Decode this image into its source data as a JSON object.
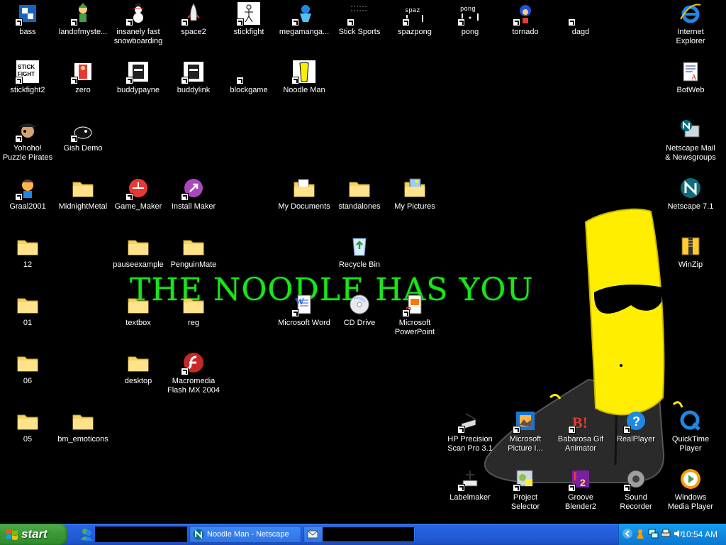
{
  "wallpaper": {
    "tagline": "THE NOODLE HAS YOU",
    "colors": {
      "background": "#000000",
      "tagline": "#1be41b",
      "noodle": "#ffee00",
      "boot": "#2a2a2a"
    }
  },
  "desktop": {
    "icons": [
      {
        "label": "bass",
        "icon": "character-sprite-icon"
      },
      {
        "label": "landofmyste...",
        "icon": "elf-sprite-icon"
      },
      {
        "label": "insanely fast snowboarding",
        "icon": "snowman-icon"
      },
      {
        "label": "space2",
        "icon": "space-shuttle-icon"
      },
      {
        "label": "stickfight",
        "icon": "stick-figure-icon"
      },
      {
        "label": "megamanga...",
        "icon": "megaman-sprite-icon"
      },
      {
        "label": "Stick Sports",
        "icon": "stick-sports-icon"
      },
      {
        "label": "spazpong",
        "icon": "spazpong-icon"
      },
      {
        "label": "pong",
        "icon": "pong-icon"
      },
      {
        "label": "tornado",
        "icon": "sonic-sprite-icon"
      },
      {
        "label": "dagd",
        "icon": "blank-shortcut-icon"
      },
      {
        "label": "Internet Explorer",
        "icon": "internet-explorer-icon"
      },
      {
        "label": "stickfight2",
        "icon": "stick-fight-logo-icon"
      },
      {
        "label": "zero",
        "icon": "zero-sprite-icon"
      },
      {
        "label": "buddypayne",
        "icon": "buddy-face-icon"
      },
      {
        "label": "buddylink",
        "icon": "buddy-face-icon"
      },
      {
        "label": "blockgame",
        "icon": "blank-shortcut-icon"
      },
      {
        "label": "Noodle Man",
        "icon": "noodle-man-icon"
      },
      {
        "label": "BotWeb",
        "icon": "web-document-icon"
      },
      {
        "label": "Yohoho! Puzzle Pirates",
        "icon": "pirate-icon"
      },
      {
        "label": "Gish Demo",
        "icon": "gish-blob-icon"
      },
      {
        "label": "Netscape Mail & Newsgroups",
        "icon": "netscape-mail-icon"
      },
      {
        "label": "Graal2001",
        "icon": "graal-character-icon"
      },
      {
        "label": "MidnightMetal",
        "icon": "folder-icon"
      },
      {
        "label": "Game_Maker",
        "icon": "game-maker-icon"
      },
      {
        "label": "Install Maker",
        "icon": "install-maker-icon"
      },
      {
        "label": "My Documents",
        "icon": "my-documents-folder-icon"
      },
      {
        "label": "standalones",
        "icon": "folder-icon"
      },
      {
        "label": "My Pictures",
        "icon": "my-pictures-folder-icon"
      },
      {
        "label": "Netscape 7.1",
        "icon": "netscape-icon"
      },
      {
        "label": "12",
        "icon": "folder-icon"
      },
      {
        "label": "pauseexample",
        "icon": "folder-icon"
      },
      {
        "label": "PenguinMate",
        "icon": "folder-icon"
      },
      {
        "label": "Recycle Bin",
        "icon": "recycle-bin-icon"
      },
      {
        "label": "WinZip",
        "icon": "winzip-icon"
      },
      {
        "label": "01",
        "icon": "folder-icon"
      },
      {
        "label": "textbox",
        "icon": "folder-icon"
      },
      {
        "label": "reg",
        "icon": "folder-icon"
      },
      {
        "label": "Microsoft Word",
        "icon": "word-document-icon"
      },
      {
        "label": "CD Drive",
        "icon": "cd-drive-icon"
      },
      {
        "label": "Microsoft PowerPoint",
        "icon": "powerpoint-icon"
      },
      {
        "label": "06",
        "icon": "folder-icon"
      },
      {
        "label": "desktop",
        "icon": "folder-icon"
      },
      {
        "label": "Macromedia Flash MX 2004",
        "icon": "flash-icon"
      },
      {
        "label": "05",
        "icon": "folder-icon"
      },
      {
        "label": "bm_emoticons",
        "icon": "folder-icon"
      },
      {
        "label": "HP Precision Scan Pro 3.1",
        "icon": "scanner-icon"
      },
      {
        "label": "Microsoft Picture I...",
        "icon": "picture-it-icon"
      },
      {
        "label": "Babarosa Gif Animator",
        "icon": "gif-animator-icon"
      },
      {
        "label": "RealPlayer",
        "icon": "realplayer-icon"
      },
      {
        "label": "QuickTime Player",
        "icon": "quicktime-icon"
      },
      {
        "label": "Labelmaker",
        "icon": "labelmaker-icon"
      },
      {
        "label": "Project Selector",
        "icon": "project-selector-icon"
      },
      {
        "label": "Groove Blender2",
        "icon": "groove-blender-icon"
      },
      {
        "label": "Sound Recorder",
        "icon": "speaker-icon"
      },
      {
        "label": "Windows Media Player",
        "icon": "media-player-icon"
      }
    ]
  },
  "taskbar": {
    "start_label": "start",
    "quicklaunch": [
      {
        "icon": "msn-messenger-icon"
      }
    ],
    "tasks": [
      {
        "label": "Noodle Man - Netscape",
        "icon": "netscape-icon"
      },
      {
        "label": "",
        "icon": "mail-envelope-icon"
      }
    ],
    "tray": {
      "icons": [
        "show-hidden-icons-chevron",
        "messenger-running-icon",
        "network-icon",
        "printer-icon",
        "volume-icon"
      ],
      "clock": "10:54 AM"
    },
    "colors": {
      "bar": "#245edb",
      "start": "#3c9b37",
      "tray": "#0e8ae0"
    }
  }
}
